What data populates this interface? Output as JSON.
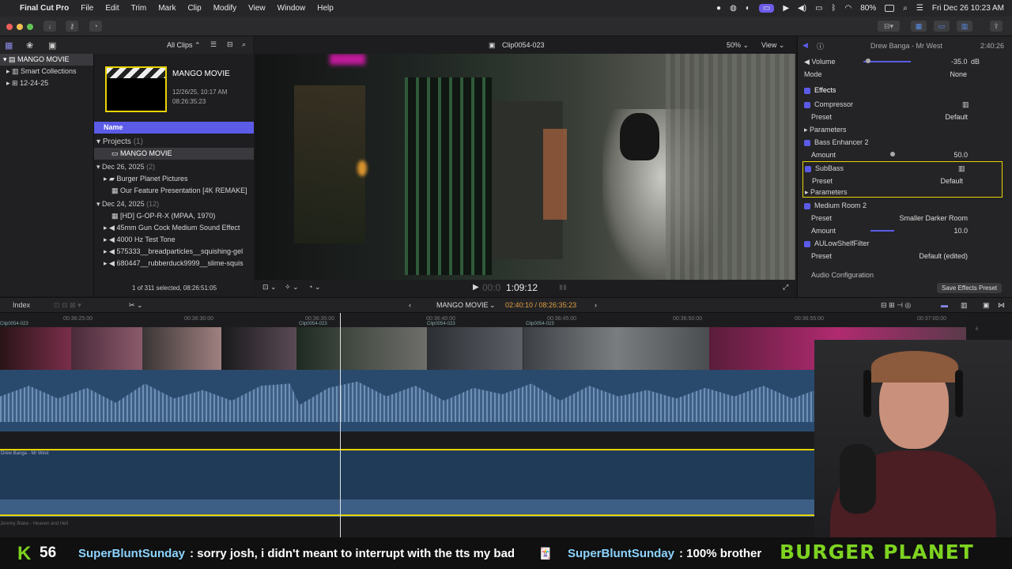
{
  "menubar": {
    "apple": "",
    "app": "Final Cut Pro",
    "items": [
      "File",
      "Edit",
      "Trim",
      "Mark",
      "Clip",
      "Modify",
      "View",
      "Window",
      "Help"
    ],
    "battery": "80%",
    "clock": "Fri Dec 26  10:23 AM"
  },
  "browser": {
    "filter": "All Clips",
    "library": "MANGO MOVIE",
    "smart": "Smart Collections",
    "event": "12-24-25",
    "project_card": {
      "title": "MANGO MOVIE",
      "date": "12/26/25, 10:17 AM",
      "duration": "08:26:35:23"
    },
    "column": "Name",
    "groups": [
      {
        "label": "Projects",
        "count": "(1)",
        "items": [
          "MANGO MOVIE"
        ]
      },
      {
        "label": "Dec 26, 2025",
        "count": "(2)",
        "items": [
          "Burger Planet Pictures",
          "Our Feature Presentation [4K REMAKE]"
        ]
      },
      {
        "label": "Dec 24, 2025",
        "count": "(12)",
        "items": [
          "[HD] G-OP-R-X (MPAA, 1970)",
          "45mm Gun Cock Medium Sound Effect",
          "4000 Hz Test Tone",
          "575333__breadparticles__squishing-gel",
          "680447__rubberduck9999__slime-squis"
        ]
      }
    ],
    "status": "1 of 311 selected, 08:26:51:05"
  },
  "viewer": {
    "clip": "Clip0054-023",
    "zoom": "50%",
    "view": "View",
    "timecode": "1:09:12",
    "tc_prefix": "00:0"
  },
  "inspector": {
    "title": "Drew Banga - Mr West",
    "duration": "2:40:26",
    "volume_label": "Volume",
    "volume_value": "-35.0",
    "volume_unit": "dB",
    "mode_label": "Mode",
    "mode_value": "None",
    "effects": "Effects",
    "rows": {
      "compressor": "Compressor",
      "preset": "Preset",
      "default": "Default",
      "parameters": "Parameters",
      "bass": "Bass Enhancer 2",
      "amount": "Amount",
      "bass_amount": "50.0",
      "subbass": "SubBass",
      "room": "Medium Room 2",
      "room_preset": "Smaller Darker Room",
      "room_amount": "10.0",
      "lowshelf": "AULowShelfFilter",
      "lowshelf_preset": "Default (edited)"
    },
    "audio_config": "Audio Configuration",
    "save_preset": "Save Effects Preset"
  },
  "timeline": {
    "index": "Index",
    "project": "MANGO MOVIE",
    "position": "02:40:10 / 08:26:35:23",
    "ruler": [
      "00:36:25:00",
      "00:36:30:00",
      "00:36:35:00",
      "00:36:40:00",
      "00:36:45:00",
      "00:36:50:00",
      "00:36:55:00",
      "00:37:00:00"
    ],
    "clip_labels": [
      "Clip0054-023",
      "Clip0054-023",
      "Clip0054-023",
      "Clip0054-023"
    ],
    "audio1": "Drew Banga - Mr West",
    "audio2": "Jeremy Blake - Heaven and Hell",
    "meter": [
      "6",
      "0",
      "-6"
    ]
  },
  "overlay": {
    "k": "K",
    "count": "56",
    "chat1_user": "SuperBluntSunday",
    "chat1_msg": ": sorry josh, i didn't meant to interrupt with the tts my bad",
    "chat2_user": "SuperBluntSunday",
    "chat2_msg": ": 100% brother",
    "brand": "BURGER PLANET"
  },
  "colors": {
    "accent": "#5b5be8",
    "playhead": "#e0e0e0",
    "yellow": "#e8d400",
    "audio": "#3d5f86",
    "track": "#2a4a6d"
  }
}
